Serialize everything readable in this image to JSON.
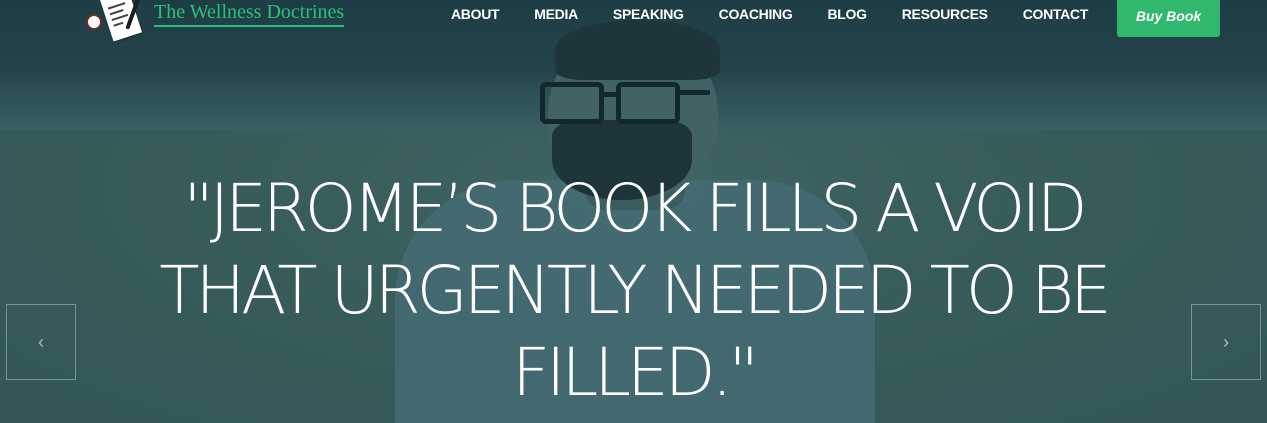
{
  "brand": {
    "name": "The Wellness Doctrines",
    "logo_icon": "notepad-coffee-pen-logo",
    "color": "#2dbf7b"
  },
  "nav": {
    "items": [
      {
        "label": "ABOUT"
      },
      {
        "label": "MEDIA"
      },
      {
        "label": "SPEAKING"
      },
      {
        "label": "COACHING"
      },
      {
        "label": "BLOG"
      },
      {
        "label": "RESOURCES"
      },
      {
        "label": "CONTACT"
      }
    ],
    "cta_label": "Buy Book",
    "cta_color": "#31b86f"
  },
  "hero": {
    "quote_lines": [
      "\"JEROME’S BOOK FILLS A VOID",
      "THAT URGENTLY NEEDED TO BE",
      "FILLED.\""
    ],
    "overlay_color": "#2e4b52"
  },
  "slider": {
    "prev_icon": "chevron-left-icon",
    "next_icon": "chevron-right-icon"
  }
}
